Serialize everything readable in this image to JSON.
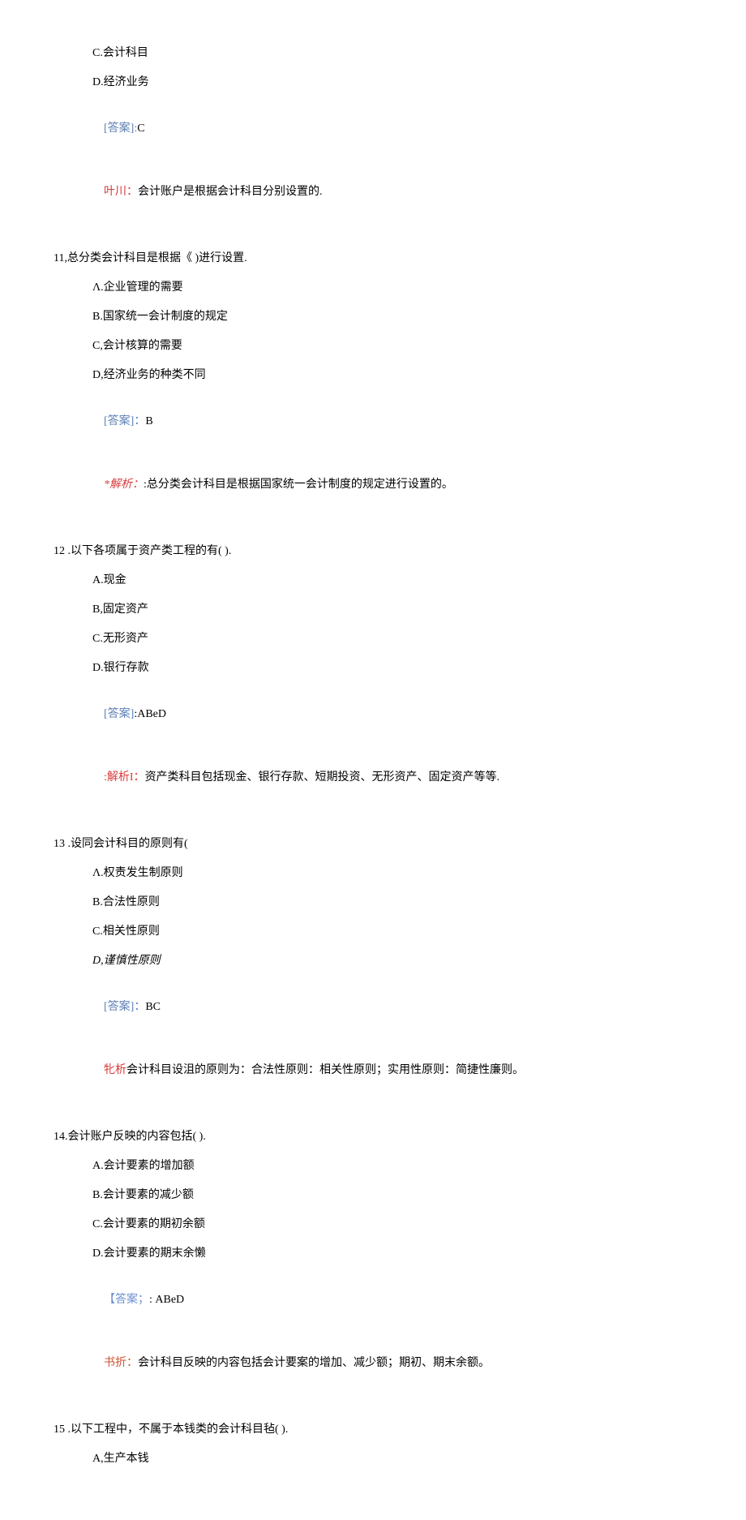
{
  "q10tail": {
    "optC": "C.会计科目",
    "optD": "D.经济业务",
    "answerLabel": "[答案]:",
    "answerValue": "C",
    "analysisLabel": "叶川：",
    "analysisText": "会计账户是根据会计科目分别设置的."
  },
  "q11": {
    "question": "11,总分类会计科目是根据《         )进行设置.",
    "optA": "Λ.企业管理的需要",
    "optB": "B.国家统一会计制度的规定",
    "optC": "C,会计核算的需要",
    "optD": "D,经济业务的种类不同",
    "answerLabel": "[答案]：",
    "answerValue": "B",
    "analysisLabel": "*解析：",
    "analysisText": ":总分类会计科目是根据国家统一会计制度的规定进行设置的。"
  },
  "q12": {
    "question": "12  .以下各项属于资产类工程的有(        ).",
    "optA": "A.现金",
    "optB": "B,固定资产",
    "optC": "C.无形资产",
    "optD": "D.银行存款",
    "answerLabel": "[答案]",
    "answerValue": ":ABeD",
    "analysisLabel": ":解析I：",
    "analysisText": "资产类科目包括现金、银行存款、短期投资、无形资产、固定资产等等."
  },
  "q13": {
    "question": "13  .设同会计科目的原则有(",
    "optA": "Λ.权责发生制原则",
    "optB": "B.合法性原则",
    "optC": "C.相关性原则",
    "optD": "D,谨慎性原则",
    "answerLabel": "[答案]：",
    "answerValue": "BC",
    "analysisLabel": "牝析",
    "analysisText": "会计科目设沮的原则为：合法性原则：相关性原则；实用性原则：简捷性廉则。"
  },
  "q14": {
    "question": "14.会计账户反映的内容包括(          ).",
    "optA": "A.会计要素的增加额",
    "optB": "B.会计要素的减少额",
    "optC": "C.会计要素的期初余额",
    "optD": "D.会计要素的期末余懒",
    "answerLabel": "【答案；",
    "answerValue": ": ABeD",
    "analysisLabel": "书折：",
    "analysisText": "会计科目反映的内容包括会计要案的增加、减少额；期初、期末余额。"
  },
  "q15": {
    "question": "15  .以下工程中，不属于本钱类的会计科目毡(         ).",
    "optA": "A,生产本钱"
  }
}
